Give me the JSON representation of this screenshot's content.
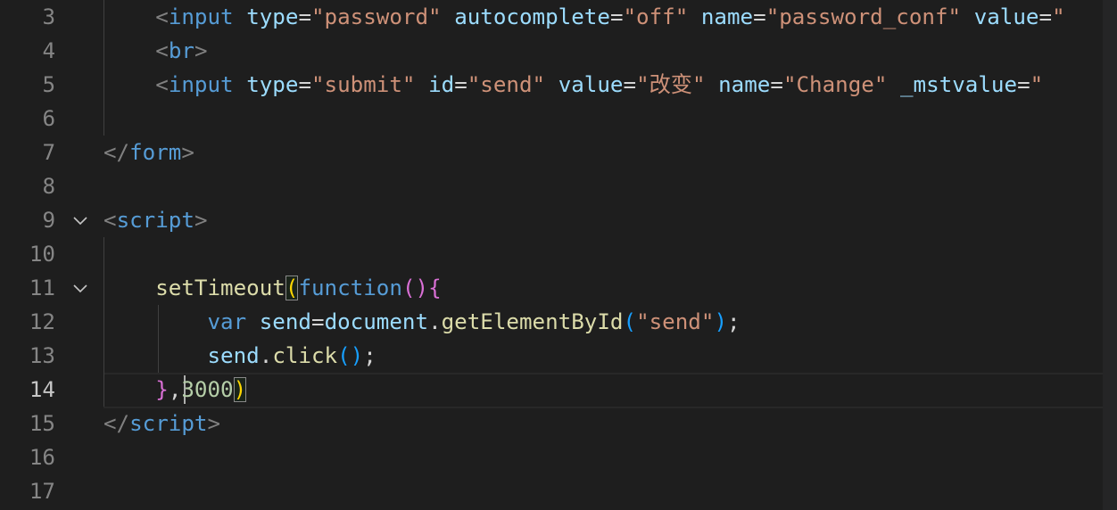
{
  "editor": {
    "lines": [
      {
        "n": "3",
        "tokens": [
          {
            "t": "    ",
            "c": "plain"
          },
          {
            "t": "<",
            "c": "punc"
          },
          {
            "t": "input",
            "c": "tag"
          },
          {
            "t": " ",
            "c": "plain"
          },
          {
            "t": "type",
            "c": "attr"
          },
          {
            "t": "=",
            "c": "eq"
          },
          {
            "t": "\"password\"",
            "c": "str"
          },
          {
            "t": " ",
            "c": "plain"
          },
          {
            "t": "autocomplete",
            "c": "attr"
          },
          {
            "t": "=",
            "c": "eq"
          },
          {
            "t": "\"off\"",
            "c": "str"
          },
          {
            "t": " ",
            "c": "plain"
          },
          {
            "t": "name",
            "c": "attr"
          },
          {
            "t": "=",
            "c": "eq"
          },
          {
            "t": "\"password_conf\"",
            "c": "str"
          },
          {
            "t": " ",
            "c": "plain"
          },
          {
            "t": "value",
            "c": "attr"
          },
          {
            "t": "=",
            "c": "eq"
          },
          {
            "t": "\"",
            "c": "str"
          }
        ]
      },
      {
        "n": "4",
        "tokens": [
          {
            "t": "    ",
            "c": "plain"
          },
          {
            "t": "<",
            "c": "punc"
          },
          {
            "t": "br",
            "c": "tag"
          },
          {
            "t": ">",
            "c": "punc"
          }
        ]
      },
      {
        "n": "5",
        "tokens": [
          {
            "t": "    ",
            "c": "plain"
          },
          {
            "t": "<",
            "c": "punc"
          },
          {
            "t": "input",
            "c": "tag"
          },
          {
            "t": " ",
            "c": "plain"
          },
          {
            "t": "type",
            "c": "attr"
          },
          {
            "t": "=",
            "c": "eq"
          },
          {
            "t": "\"submit\"",
            "c": "str"
          },
          {
            "t": " ",
            "c": "plain"
          },
          {
            "t": "id",
            "c": "attr"
          },
          {
            "t": "=",
            "c": "eq"
          },
          {
            "t": "\"send\"",
            "c": "str"
          },
          {
            "t": " ",
            "c": "plain"
          },
          {
            "t": "value",
            "c": "attr"
          },
          {
            "t": "=",
            "c": "eq"
          },
          {
            "t": "\"改变\"",
            "c": "str"
          },
          {
            "t": " ",
            "c": "plain"
          },
          {
            "t": "name",
            "c": "attr"
          },
          {
            "t": "=",
            "c": "eq"
          },
          {
            "t": "\"Change\"",
            "c": "str"
          },
          {
            "t": " ",
            "c": "plain"
          },
          {
            "t": "_mstvalue",
            "c": "attr"
          },
          {
            "t": "=",
            "c": "eq"
          },
          {
            "t": "\"",
            "c": "str"
          }
        ]
      },
      {
        "n": "6",
        "tokens": []
      },
      {
        "n": "7",
        "tokens": [
          {
            "t": "</",
            "c": "punc"
          },
          {
            "t": "form",
            "c": "tag"
          },
          {
            "t": ">",
            "c": "punc"
          }
        ]
      },
      {
        "n": "8",
        "tokens": []
      },
      {
        "n": "9",
        "fold": true,
        "tokens": [
          {
            "t": "<",
            "c": "punc"
          },
          {
            "t": "script",
            "c": "tag"
          },
          {
            "t": ">",
            "c": "punc"
          }
        ]
      },
      {
        "n": "10",
        "tokens": []
      },
      {
        "n": "11",
        "fold": true,
        "tokens": [
          {
            "t": "    ",
            "c": "plain"
          },
          {
            "t": "setTimeout",
            "c": "fn"
          },
          {
            "t": "(",
            "c": "b1",
            "m": true
          },
          {
            "t": "function",
            "c": "kw"
          },
          {
            "t": "()",
            "c": "b2"
          },
          {
            "t": "{",
            "c": "b2"
          }
        ]
      },
      {
        "n": "12",
        "tokens": [
          {
            "t": "        ",
            "c": "plain"
          },
          {
            "t": "var",
            "c": "kw"
          },
          {
            "t": " ",
            "c": "plain"
          },
          {
            "t": "send",
            "c": "var"
          },
          {
            "t": "=",
            "c": "plain"
          },
          {
            "t": "document",
            "c": "var"
          },
          {
            "t": ".",
            "c": "plain"
          },
          {
            "t": "getElementById",
            "c": "fn"
          },
          {
            "t": "(",
            "c": "b3"
          },
          {
            "t": "\"send\"",
            "c": "str"
          },
          {
            "t": ")",
            "c": "b3"
          },
          {
            "t": ";",
            "c": "plain"
          }
        ]
      },
      {
        "n": "13",
        "tokens": [
          {
            "t": "        ",
            "c": "plain"
          },
          {
            "t": "send",
            "c": "var"
          },
          {
            "t": ".",
            "c": "plain"
          },
          {
            "t": "click",
            "c": "fn"
          },
          {
            "t": "()",
            "c": "b3"
          },
          {
            "t": ";",
            "c": "plain"
          }
        ]
      },
      {
        "n": "14",
        "active": true,
        "tokens": [
          {
            "t": "    ",
            "c": "plain"
          },
          {
            "t": "}",
            "c": "b2"
          },
          {
            "t": ",",
            "c": "plain"
          },
          {
            "t": "3000",
            "c": "num"
          },
          {
            "t": ")",
            "c": "b1",
            "m": true
          }
        ]
      },
      {
        "n": "15",
        "tokens": [
          {
            "t": "</",
            "c": "punc"
          },
          {
            "t": "script",
            "c": "tag"
          },
          {
            "t": ">",
            "c": "punc"
          }
        ]
      },
      {
        "n": "16",
        "tokens": []
      },
      {
        "n": "17",
        "tokens": []
      }
    ]
  }
}
